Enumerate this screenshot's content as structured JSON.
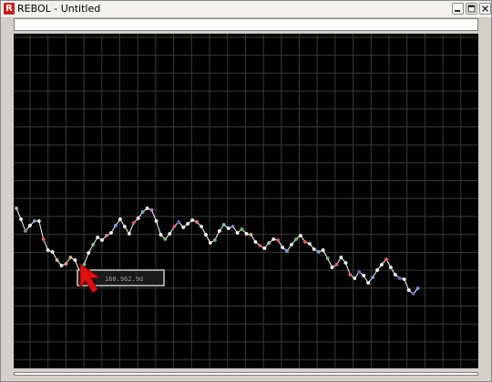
{
  "window": {
    "title": "REBOL - Untitled",
    "icon_letter": "R",
    "icon_color": "#c81e1e"
  },
  "icons": {
    "app": "rebol-app-icon",
    "minimize": "minimize-icon",
    "maximize": "maximize-icon",
    "close": "close-icon",
    "cursor": "red-arrow-cursor-icon"
  },
  "field": {
    "value": ""
  },
  "chart_data": {
    "type": "line",
    "background": "#000000",
    "grid": true,
    "grid_color": "#3a3a3a",
    "line_color": "#ffffff",
    "y": [
      228,
      240,
      253,
      247,
      242,
      242,
      262,
      274,
      276,
      285,
      291,
      289,
      282,
      285,
      297,
      290,
      277,
      268,
      260,
      263,
      258,
      255,
      247,
      240,
      248,
      256,
      244,
      239,
      232,
      228,
      230,
      242,
      257,
      262,
      256,
      248,
      243,
      249,
      245,
      241,
      243,
      248,
      257,
      266,
      263,
      253,
      246,
      250,
      248,
      255,
      251,
      256,
      257,
      265,
      269,
      272,
      266,
      262,
      263,
      271,
      275,
      268,
      262,
      258,
      265,
      267,
      273,
      276,
      274,
      283,
      293,
      290,
      282,
      288,
      301,
      305,
      298,
      302,
      310,
      304,
      296,
      290,
      284,
      293,
      301,
      305,
      306,
      318,
      322,
      316
    ],
    "point_colors": [
      "#9fd69f",
      "#ffffff",
      "#b06db8",
      "#ffffff",
      "#8aa8e0",
      "#ffffff",
      "#e06060",
      "#ffffff",
      "#ffffff",
      "#d8c070",
      "#ffffff",
      "#ff9090",
      "#d8c070",
      "#ffffff",
      "#ffffff",
      "#6ad1b1",
      "#ffffff",
      "#7fd07f",
      "#ffffff",
      "#ffffff",
      "#e080a0",
      "#ffffff",
      "#7aa0e8",
      "#ffffff",
      "#ffffff",
      "#ffffff",
      "#e06060",
      "#ffffff",
      "#8aa8e0",
      "#ffffff",
      "#d07ad0",
      "#ffffff",
      "#ffffff",
      "#70c070",
      "#ffffff",
      "#e06070",
      "#7060c0",
      "#ffffff",
      "#ffffff",
      "#ffffff",
      "#e08080",
      "#ffffff",
      "#ffffff",
      "#ffffff",
      "#70c070",
      "#ffffff",
      "#6ad1b1",
      "#ffffff",
      "#8080e0",
      "#ffffff",
      "#70c070",
      "#ffffff",
      "#d8c070",
      "#ffffff",
      "#e06070",
      "#ffffff",
      "#9fd69f",
      "#ffffff",
      "#e06060",
      "#ffffff",
      "#7aa0e8",
      "#ffffff",
      "#70c070",
      "#ffffff",
      "#e06060",
      "#ffffff",
      "#ffffff",
      "#8aa8e0",
      "#ffffff",
      "#70c070",
      "#ffffff",
      "#e06060",
      "#ffffff",
      "#ffffff",
      "#e06070",
      "#ffffff",
      "#7060c0",
      "#ffffff",
      "#ffffff",
      "#70a0e0",
      "#ffffff",
      "#ffffff",
      "#e06060",
      "#ffffff",
      "#ffffff",
      "#7060c0",
      "#ffffff",
      "#ffffff",
      "#7060c0",
      "#7aa0e8"
    ]
  },
  "tooltip": {
    "text": "160.962.9d",
    "anchor_index": 15
  }
}
